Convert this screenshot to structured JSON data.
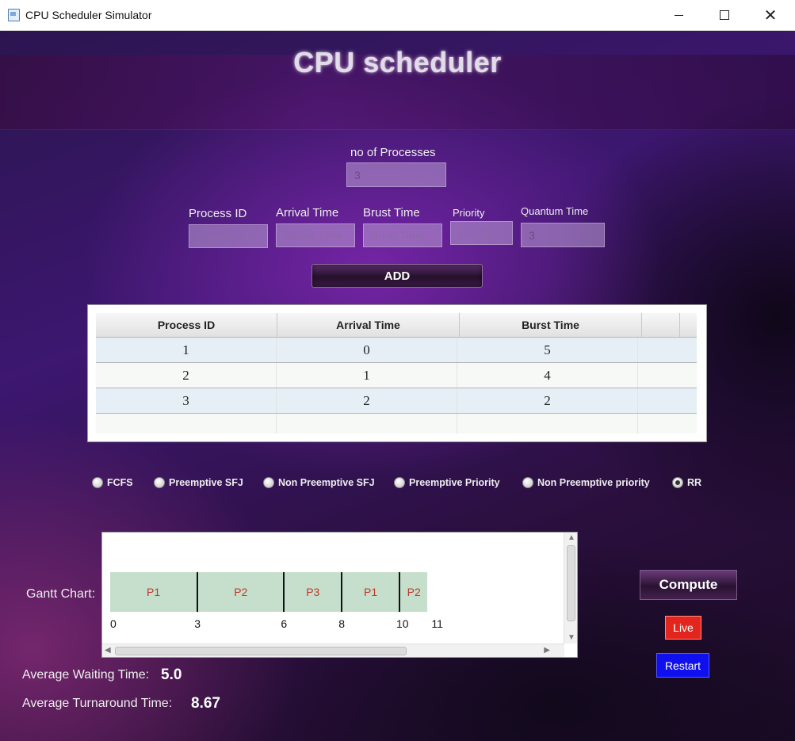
{
  "window": {
    "title": "CPU Scheduler Simulator",
    "icon": "app-window-icon"
  },
  "header": {
    "title": "CPU scheduler"
  },
  "num_processes": {
    "label": "no of Processes",
    "value": "3"
  },
  "inputs": {
    "process_id": {
      "label": "Process ID",
      "placeholder": "Process ID"
    },
    "arrival_time": {
      "label": "Arrival Time",
      "placeholder": "Arrival Time"
    },
    "burst_time": {
      "label": "Brust Time",
      "placeholder": "Brust Time"
    },
    "priority": {
      "label": "Priority",
      "placeholder": "priority"
    },
    "quantum_time": {
      "label": "Quantum Time",
      "value": "3"
    }
  },
  "add_button": "ADD",
  "table": {
    "columns": [
      "Process ID",
      "Arrival Time",
      "Burst Time"
    ],
    "rows": [
      [
        "1",
        "0",
        "5"
      ],
      [
        "2",
        "1",
        "4"
      ],
      [
        "3",
        "2",
        "2"
      ]
    ]
  },
  "algorithms": {
    "options": [
      "FCFS",
      "Preemptive SFJ",
      "Non Preemptive SFJ",
      "Preemptive Priority",
      "Non Preemptive priority",
      "RR"
    ],
    "selected": "RR"
  },
  "gantt": {
    "label": "Gantt Chart:",
    "segments": [
      {
        "name": "P1",
        "start": 0,
        "end": 3
      },
      {
        "name": "P2",
        "start": 3,
        "end": 6
      },
      {
        "name": "P3",
        "start": 6,
        "end": 8
      },
      {
        "name": "P1",
        "start": 8,
        "end": 10
      },
      {
        "name": "P2",
        "start": 10,
        "end": 11
      }
    ],
    "ticks": [
      "0",
      "3",
      "6",
      "8",
      "10",
      "11"
    ],
    "bar_color": "#c5dfcc",
    "label_color": "#c0392b"
  },
  "buttons": {
    "compute": "Compute",
    "live": "Live",
    "restart": "Restart"
  },
  "colors": {
    "live": "#e3261d",
    "restart": "#1010ee"
  },
  "stats": {
    "avg_waiting_label": "Average Waiting Time:",
    "avg_waiting_value": "5.0",
    "avg_turnaround_label": "Average Turnaround Time:",
    "avg_turnaround_value": "8.67"
  }
}
